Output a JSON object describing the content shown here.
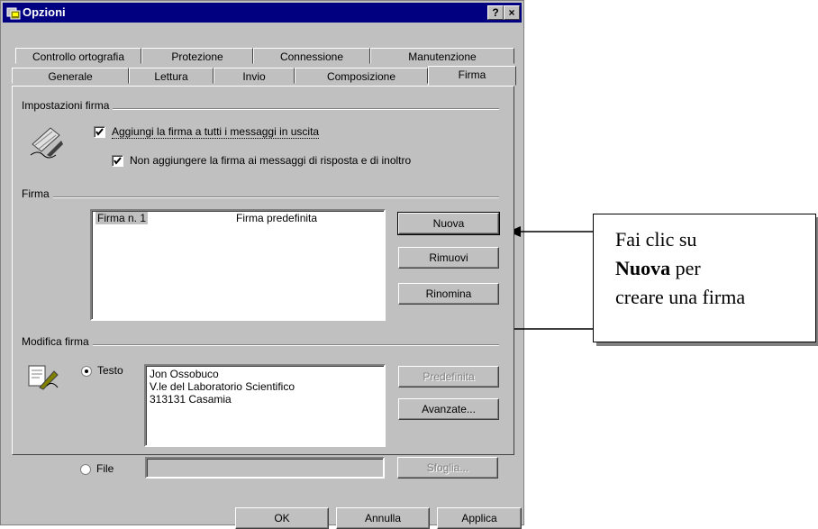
{
  "window": {
    "title": "Opzioni",
    "help_btn": "?",
    "close_btn": "×"
  },
  "tabs_row1": [
    "Controllo ortografia",
    "Protezione",
    "Connessione",
    "Manutenzione"
  ],
  "tabs_row2": [
    "Generale",
    "Lettura",
    "Invio",
    "Composizione",
    "Firma"
  ],
  "impostazioni": {
    "group_title": "Impostazioni firma",
    "chk1_label": "Aggiungi la firma a tutti i messaggi in uscita",
    "chk2_label": "Non aggiungere la  firma ai messaggi di risposta e di inoltro"
  },
  "firma": {
    "group_title": "Firma",
    "list_name": "Firma n. 1",
    "list_default": "Firma predefinita",
    "btn_nuova": "Nuova",
    "btn_rimuovi": "Rimuovi",
    "btn_rinomina": "Rinomina"
  },
  "modifica": {
    "group_title": "Modifica firma",
    "radio_testo": "Testo",
    "text_line1": "Jon Ossobuco",
    "text_line2": "V.le del Laboratorio Scientifico",
    "text_line3": "313131 Casamia",
    "btn_predefinita": "Predefinita",
    "btn_avanzate": "Avanzate...",
    "radio_file": "File",
    "btn_sfoglia": "Sfoglia..."
  },
  "footer": {
    "ok": "OK",
    "annulla": "Annulla",
    "applica": "Applica"
  },
  "callout": {
    "line1": "Fai clic  su",
    "line2_bold": "Nuova",
    "line2_rest": " per",
    "line3": "creare una firma"
  },
  "colors": {
    "titlebar": "#000080",
    "face": "#c0c0c0"
  },
  "icons": [
    "window-icon",
    "help-icon",
    "close-icon",
    "signature-icon",
    "edit-signature-icon",
    "arrow-icon"
  ]
}
